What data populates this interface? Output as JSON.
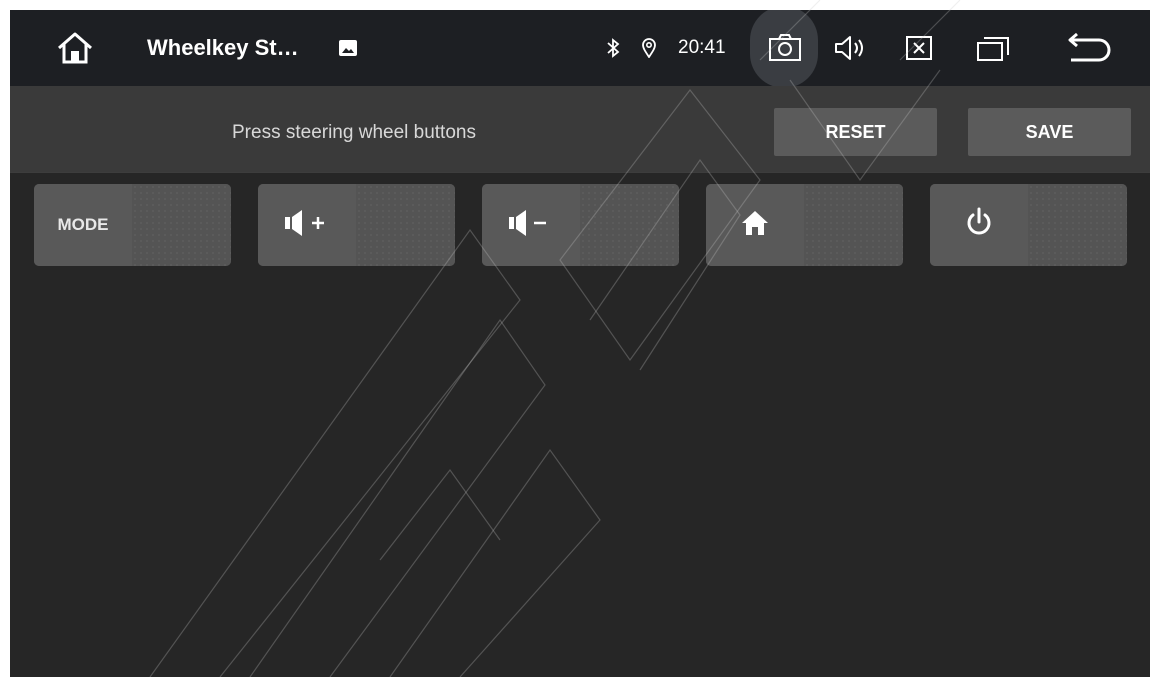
{
  "statusbar": {
    "app_title": "Wheelkey St…",
    "time": "20:41",
    "icons": [
      "home-icon",
      "image-icon",
      "bluetooth-icon",
      "location-icon",
      "camera-icon",
      "volume-icon",
      "close-window-icon",
      "recent-apps-icon",
      "back-icon"
    ]
  },
  "toolbar": {
    "hint": "Press steering wheel buttons",
    "reset_label": "RESET",
    "save_label": "SAVE"
  },
  "keys": [
    {
      "label": "MODE",
      "icon": null
    },
    {
      "label": "",
      "icon": "volume-up-icon"
    },
    {
      "label": "",
      "icon": "volume-down-icon"
    },
    {
      "label": "",
      "icon": "home-icon"
    },
    {
      "label": "",
      "icon": "power-icon"
    }
  ],
  "colors": {
    "statusbar_bg": "#1d1f23",
    "toolbar_bg": "#3a3a3a",
    "content_bg": "#262626",
    "button_bg": "#5b5b5b",
    "key_bg": "#4e4e4e"
  }
}
